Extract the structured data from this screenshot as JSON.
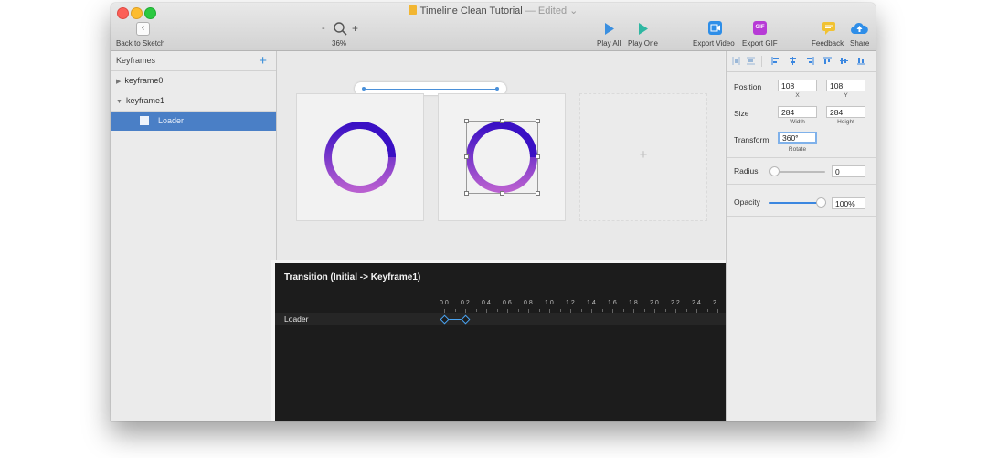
{
  "window": {
    "title": "Timeline Clean Tutorial",
    "edited_suffix": "— Edited ⌄"
  },
  "toolbar": {
    "back_label": "Back to Sketch",
    "zoom_minus": "-",
    "zoom_plus": "+",
    "zoom_value": "36%",
    "play_all": "Play All",
    "play_one": "Play One",
    "export_video": "Export Video",
    "export_gif": "Export GIF",
    "gif_badge": "GIF",
    "feedback": "Feedback",
    "share": "Share"
  },
  "sidebar": {
    "header": "Keyframes",
    "add_symbol": "+",
    "keyframes": [
      {
        "label": "keyframe0",
        "expanded": false
      },
      {
        "label": "keyframe1",
        "expanded": true
      }
    ],
    "layers": [
      {
        "label": "Loader"
      }
    ]
  },
  "canvas": {
    "add_symbol": "+"
  },
  "inspector": {
    "position_label": "Position",
    "position_x": "108",
    "position_y": "108",
    "x_label": "X",
    "y_label": "Y",
    "size_label": "Size",
    "width": "284",
    "height": "284",
    "width_label": "Width",
    "height_label": "Height",
    "transform_label": "Transform",
    "rotate": "360°",
    "rotate_label": "Rotate",
    "radius_label": "Radius",
    "radius_value": "0",
    "radius_level": 0,
    "opacity_label": "Opacity",
    "opacity_value": "100%",
    "opacity_level": 1.0
  },
  "timeline": {
    "title": "Transition (Initial -> Keyframe1)",
    "ruler": [
      "0.0",
      "0.2",
      "0.4",
      "0.6",
      "0.8",
      "1.0",
      "1.2",
      "1.4",
      "1.6",
      "1.8",
      "2.0",
      "2.2",
      "2.4",
      "2."
    ],
    "rows": [
      {
        "label": "Loader",
        "start": 0.0,
        "end": 0.2
      }
    ]
  },
  "colors": {
    "accent": "#3b87e0",
    "selection": "#4a7fc6",
    "timeline_bg": "#1c1c1c",
    "ring_dark": "#3a10c4",
    "ring_light": "#b85fd0"
  }
}
